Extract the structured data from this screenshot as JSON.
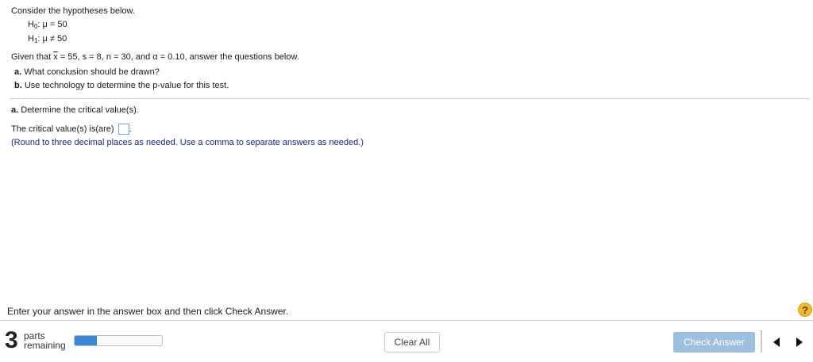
{
  "question": {
    "intro": "Consider the hypotheses below.",
    "h0": {
      "symbol": "H",
      "sub": "0",
      "rest": ": μ = 50"
    },
    "h1": {
      "symbol": "H",
      "sub": "1",
      "rest": ": μ ≠ 50"
    },
    "given_prefix": "Given that ",
    "given_xbar": "x",
    "given_rest": " = 55, s = 8, n = 30, and α = 0.10, answer the questions below.",
    "part_a_label": "a.",
    "part_a_text": " What conclusion should be drawn?",
    "part_b_label": "b.",
    "part_b_text": " Use technology to determine the p-value for this test."
  },
  "current_part": {
    "label": "a.",
    "text": " Determine the critical value(s).",
    "answer_prompt": "The critical value(s) is(are)",
    "answer_value": "",
    "answer_suffix": ".",
    "hint": "(Round to three decimal places as needed. Use a comma to separate answers as needed.)"
  },
  "footer": {
    "instruction": "Enter your answer in the answer box and then click Check Answer.",
    "help_icon": "?",
    "parts_count": "3",
    "parts_line1": "parts",
    "parts_line2": "remaining",
    "progress_fraction": 0.25,
    "clear_all_label": "Clear All",
    "check_answer_label": "Check Answer"
  },
  "colors": {
    "accent_blue": "#3b86d6",
    "check_button_disabled": "#9cc0de",
    "hint_text": "#1a1f8f",
    "help_icon": "#f2b928"
  }
}
